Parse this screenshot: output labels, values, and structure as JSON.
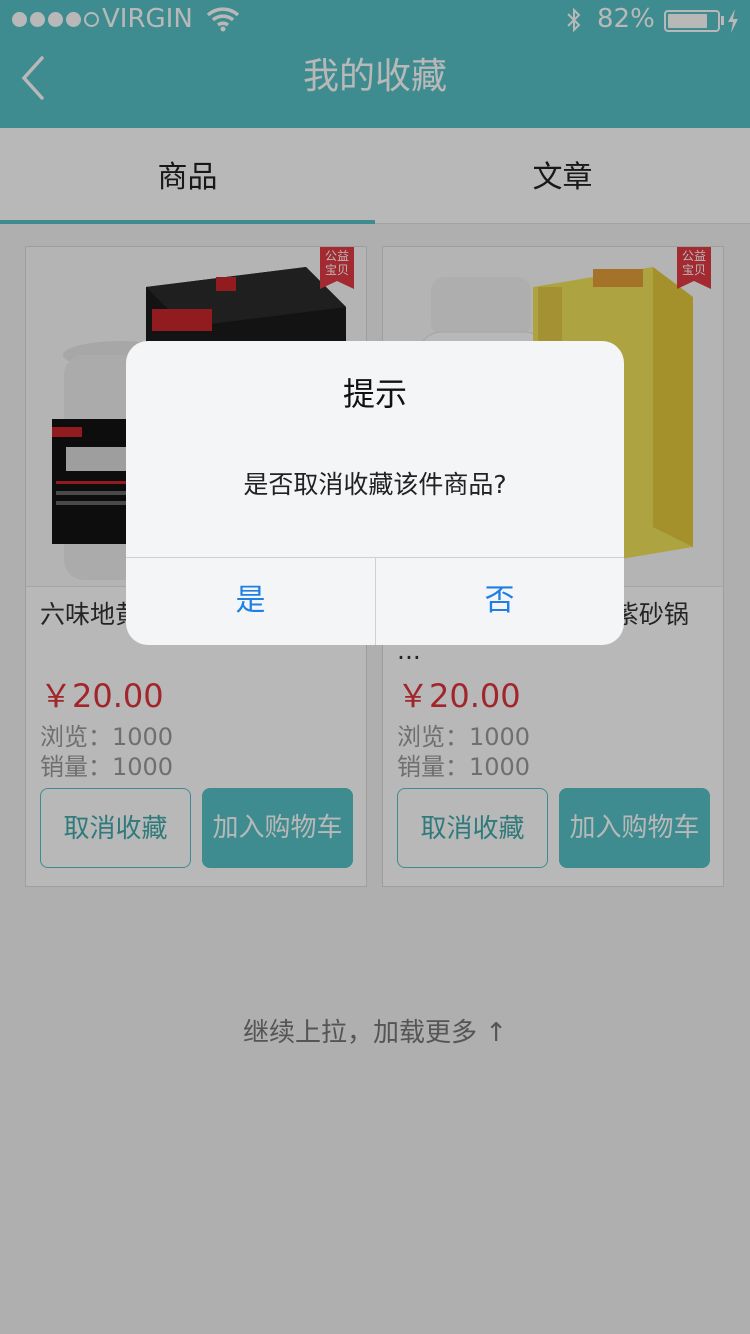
{
  "status_bar": {
    "carrier": "VIRGIN",
    "battery": "82%",
    "battery_level": 0.82
  },
  "nav": {
    "title": "我的收藏"
  },
  "tabs": [
    {
      "label": "商品",
      "active": true
    },
    {
      "label": "文章",
      "active": false
    }
  ],
  "products": [
    {
      "badge": "公益\n宝贝",
      "name": "六味地黄丸",
      "price": "￥20.00",
      "views": "浏览：1000",
      "sales": "销量：1000",
      "cancel_label": "取消收藏",
      "cart_label": "加入购物车"
    },
    {
      "badge": "公益\n宝贝",
      "name": "精乌胶囊/方形煎锅/紫砂锅 ...",
      "price": "￥20.00",
      "views": "浏览：1000",
      "sales": "销量：1000",
      "cancel_label": "取消收藏",
      "cart_label": "加入购物车"
    }
  ],
  "load_more": "继续上拉，加载更多 ↑",
  "dialog": {
    "title": "提示",
    "message": "是否取消收藏该件商品?",
    "yes": "是",
    "no": "否"
  },
  "colors": {
    "brand": "#56c3c6",
    "price": "#e0343c",
    "dialog_button": "#1e7fe6"
  }
}
